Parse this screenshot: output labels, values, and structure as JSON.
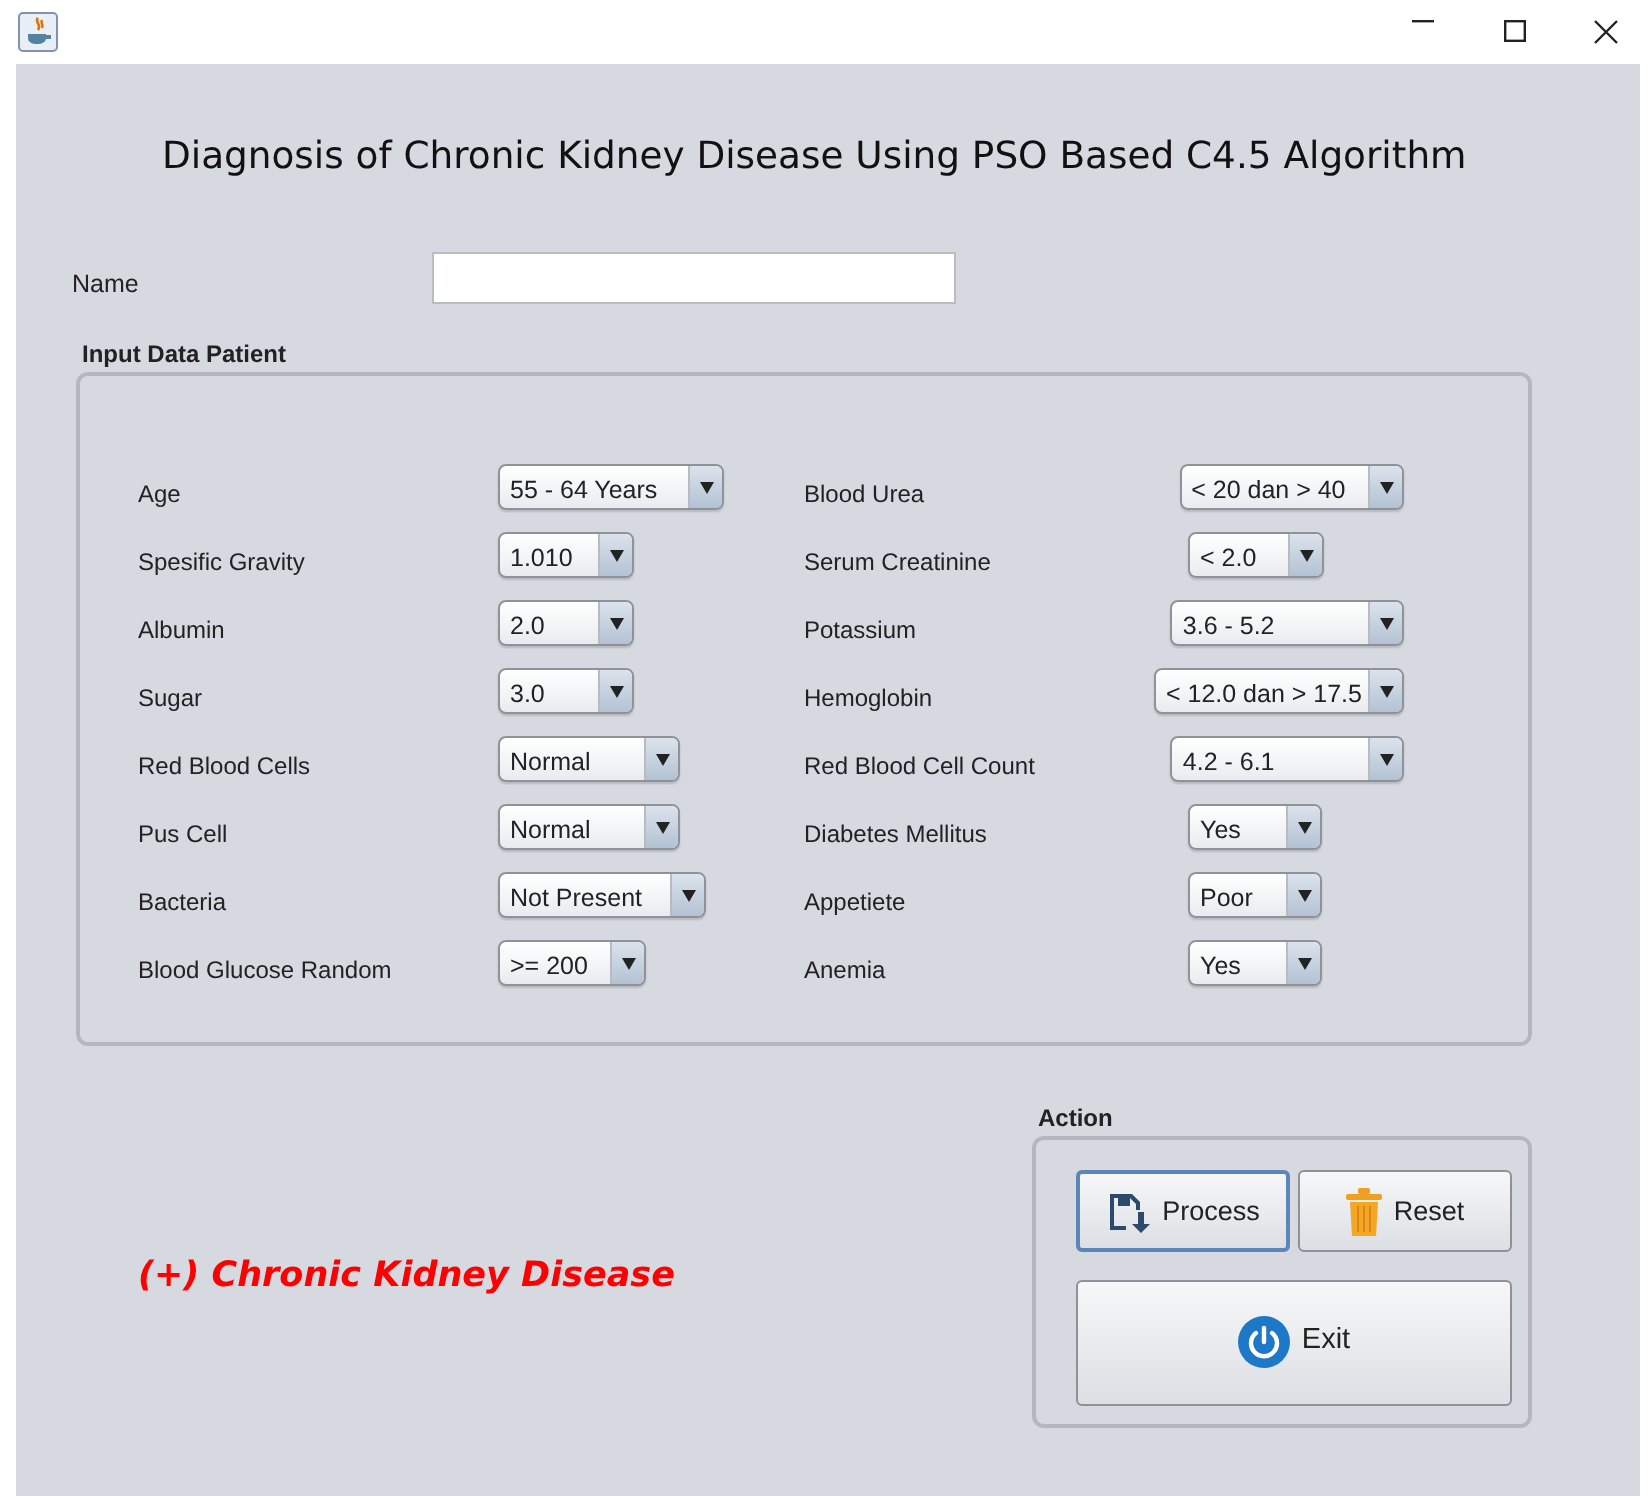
{
  "heading": "Diagnosis of Chronic Kidney Disease Using PSO Based C4.5 Algorithm",
  "name_field": {
    "label": "Name"
  },
  "input_panel": {
    "title": "Input Data Patient",
    "left_column": [
      {
        "label": "Age",
        "value": "55 - 64 Years"
      },
      {
        "label": "Spesific Gravity",
        "value": "1.010"
      },
      {
        "label": "Albumin",
        "value": "2.0"
      },
      {
        "label": "Sugar",
        "value": "3.0"
      },
      {
        "label": "Red Blood Cells",
        "value": "Normal"
      },
      {
        "label": "Pus Cell",
        "value": "Normal"
      },
      {
        "label": "Bacteria",
        "value": "Not Present"
      },
      {
        "label": "Blood Glucose Random",
        "value": ">= 200"
      }
    ],
    "right_column": [
      {
        "label": "Blood Urea",
        "value": "< 20 dan > 40"
      },
      {
        "label": "Serum Creatinine",
        "value": "< 2.0"
      },
      {
        "label": "Potassium",
        "value": "3.6 - 5.2"
      },
      {
        "label": "Hemoglobin",
        "value": "< 12.0 dan > 17.5"
      },
      {
        "label": "Red Blood Cell Count",
        "value": "4.2 - 6.1"
      },
      {
        "label": "Diabetes Mellitus",
        "value": "Yes"
      },
      {
        "label": "Appetiete",
        "value": "Poor"
      },
      {
        "label": "Anemia",
        "value": "Yes"
      }
    ]
  },
  "result": "(+) Chronic Kidney Disease",
  "action_panel": {
    "title": "Action",
    "buttons": [
      {
        "kind": "process",
        "label": "Process",
        "focused": true
      },
      {
        "kind": "reset",
        "label": "Reset",
        "focused": false
      },
      {
        "kind": "exit",
        "label": "Exit",
        "focused": false
      }
    ]
  }
}
